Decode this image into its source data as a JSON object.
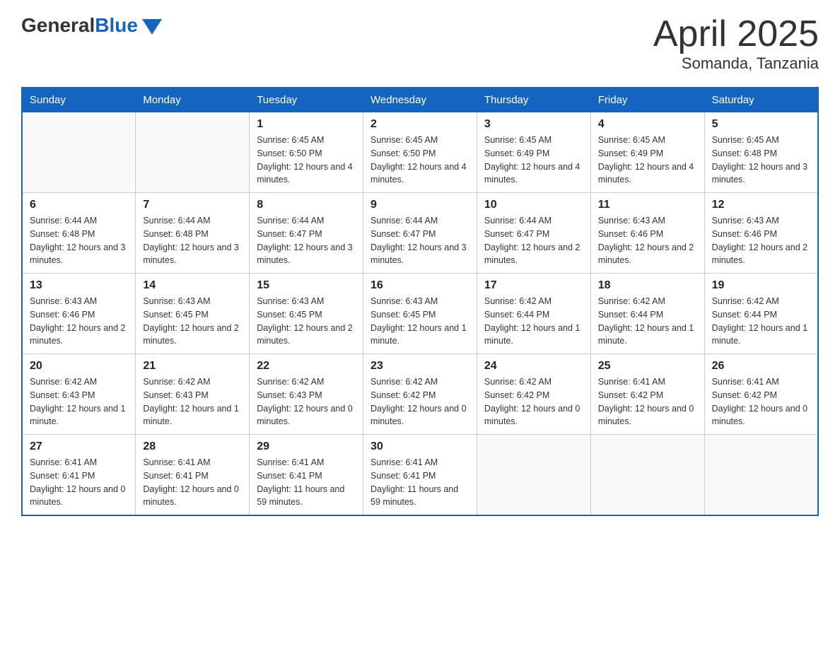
{
  "header": {
    "logo": {
      "general": "General",
      "blue": "Blue"
    },
    "title": "April 2025",
    "subtitle": "Somanda, Tanzania"
  },
  "calendar": {
    "days_of_week": [
      "Sunday",
      "Monday",
      "Tuesday",
      "Wednesday",
      "Thursday",
      "Friday",
      "Saturday"
    ],
    "weeks": [
      [
        {
          "day": "",
          "sunrise": "",
          "sunset": "",
          "daylight": ""
        },
        {
          "day": "",
          "sunrise": "",
          "sunset": "",
          "daylight": ""
        },
        {
          "day": "1",
          "sunrise": "Sunrise: 6:45 AM",
          "sunset": "Sunset: 6:50 PM",
          "daylight": "Daylight: 12 hours and 4 minutes."
        },
        {
          "day": "2",
          "sunrise": "Sunrise: 6:45 AM",
          "sunset": "Sunset: 6:50 PM",
          "daylight": "Daylight: 12 hours and 4 minutes."
        },
        {
          "day": "3",
          "sunrise": "Sunrise: 6:45 AM",
          "sunset": "Sunset: 6:49 PM",
          "daylight": "Daylight: 12 hours and 4 minutes."
        },
        {
          "day": "4",
          "sunrise": "Sunrise: 6:45 AM",
          "sunset": "Sunset: 6:49 PM",
          "daylight": "Daylight: 12 hours and 4 minutes."
        },
        {
          "day": "5",
          "sunrise": "Sunrise: 6:45 AM",
          "sunset": "Sunset: 6:48 PM",
          "daylight": "Daylight: 12 hours and 3 minutes."
        }
      ],
      [
        {
          "day": "6",
          "sunrise": "Sunrise: 6:44 AM",
          "sunset": "Sunset: 6:48 PM",
          "daylight": "Daylight: 12 hours and 3 minutes."
        },
        {
          "day": "7",
          "sunrise": "Sunrise: 6:44 AM",
          "sunset": "Sunset: 6:48 PM",
          "daylight": "Daylight: 12 hours and 3 minutes."
        },
        {
          "day": "8",
          "sunrise": "Sunrise: 6:44 AM",
          "sunset": "Sunset: 6:47 PM",
          "daylight": "Daylight: 12 hours and 3 minutes."
        },
        {
          "day": "9",
          "sunrise": "Sunrise: 6:44 AM",
          "sunset": "Sunset: 6:47 PM",
          "daylight": "Daylight: 12 hours and 3 minutes."
        },
        {
          "day": "10",
          "sunrise": "Sunrise: 6:44 AM",
          "sunset": "Sunset: 6:47 PM",
          "daylight": "Daylight: 12 hours and 2 minutes."
        },
        {
          "day": "11",
          "sunrise": "Sunrise: 6:43 AM",
          "sunset": "Sunset: 6:46 PM",
          "daylight": "Daylight: 12 hours and 2 minutes."
        },
        {
          "day": "12",
          "sunrise": "Sunrise: 6:43 AM",
          "sunset": "Sunset: 6:46 PM",
          "daylight": "Daylight: 12 hours and 2 minutes."
        }
      ],
      [
        {
          "day": "13",
          "sunrise": "Sunrise: 6:43 AM",
          "sunset": "Sunset: 6:46 PM",
          "daylight": "Daylight: 12 hours and 2 minutes."
        },
        {
          "day": "14",
          "sunrise": "Sunrise: 6:43 AM",
          "sunset": "Sunset: 6:45 PM",
          "daylight": "Daylight: 12 hours and 2 minutes."
        },
        {
          "day": "15",
          "sunrise": "Sunrise: 6:43 AM",
          "sunset": "Sunset: 6:45 PM",
          "daylight": "Daylight: 12 hours and 2 minutes."
        },
        {
          "day": "16",
          "sunrise": "Sunrise: 6:43 AM",
          "sunset": "Sunset: 6:45 PM",
          "daylight": "Daylight: 12 hours and 1 minute."
        },
        {
          "day": "17",
          "sunrise": "Sunrise: 6:42 AM",
          "sunset": "Sunset: 6:44 PM",
          "daylight": "Daylight: 12 hours and 1 minute."
        },
        {
          "day": "18",
          "sunrise": "Sunrise: 6:42 AM",
          "sunset": "Sunset: 6:44 PM",
          "daylight": "Daylight: 12 hours and 1 minute."
        },
        {
          "day": "19",
          "sunrise": "Sunrise: 6:42 AM",
          "sunset": "Sunset: 6:44 PM",
          "daylight": "Daylight: 12 hours and 1 minute."
        }
      ],
      [
        {
          "day": "20",
          "sunrise": "Sunrise: 6:42 AM",
          "sunset": "Sunset: 6:43 PM",
          "daylight": "Daylight: 12 hours and 1 minute."
        },
        {
          "day": "21",
          "sunrise": "Sunrise: 6:42 AM",
          "sunset": "Sunset: 6:43 PM",
          "daylight": "Daylight: 12 hours and 1 minute."
        },
        {
          "day": "22",
          "sunrise": "Sunrise: 6:42 AM",
          "sunset": "Sunset: 6:43 PM",
          "daylight": "Daylight: 12 hours and 0 minutes."
        },
        {
          "day": "23",
          "sunrise": "Sunrise: 6:42 AM",
          "sunset": "Sunset: 6:42 PM",
          "daylight": "Daylight: 12 hours and 0 minutes."
        },
        {
          "day": "24",
          "sunrise": "Sunrise: 6:42 AM",
          "sunset": "Sunset: 6:42 PM",
          "daylight": "Daylight: 12 hours and 0 minutes."
        },
        {
          "day": "25",
          "sunrise": "Sunrise: 6:41 AM",
          "sunset": "Sunset: 6:42 PM",
          "daylight": "Daylight: 12 hours and 0 minutes."
        },
        {
          "day": "26",
          "sunrise": "Sunrise: 6:41 AM",
          "sunset": "Sunset: 6:42 PM",
          "daylight": "Daylight: 12 hours and 0 minutes."
        }
      ],
      [
        {
          "day": "27",
          "sunrise": "Sunrise: 6:41 AM",
          "sunset": "Sunset: 6:41 PM",
          "daylight": "Daylight: 12 hours and 0 minutes."
        },
        {
          "day": "28",
          "sunrise": "Sunrise: 6:41 AM",
          "sunset": "Sunset: 6:41 PM",
          "daylight": "Daylight: 12 hours and 0 minutes."
        },
        {
          "day": "29",
          "sunrise": "Sunrise: 6:41 AM",
          "sunset": "Sunset: 6:41 PM",
          "daylight": "Daylight: 11 hours and 59 minutes."
        },
        {
          "day": "30",
          "sunrise": "Sunrise: 6:41 AM",
          "sunset": "Sunset: 6:41 PM",
          "daylight": "Daylight: 11 hours and 59 minutes."
        },
        {
          "day": "",
          "sunrise": "",
          "sunset": "",
          "daylight": ""
        },
        {
          "day": "",
          "sunrise": "",
          "sunset": "",
          "daylight": ""
        },
        {
          "day": "",
          "sunrise": "",
          "sunset": "",
          "daylight": ""
        }
      ]
    ]
  }
}
